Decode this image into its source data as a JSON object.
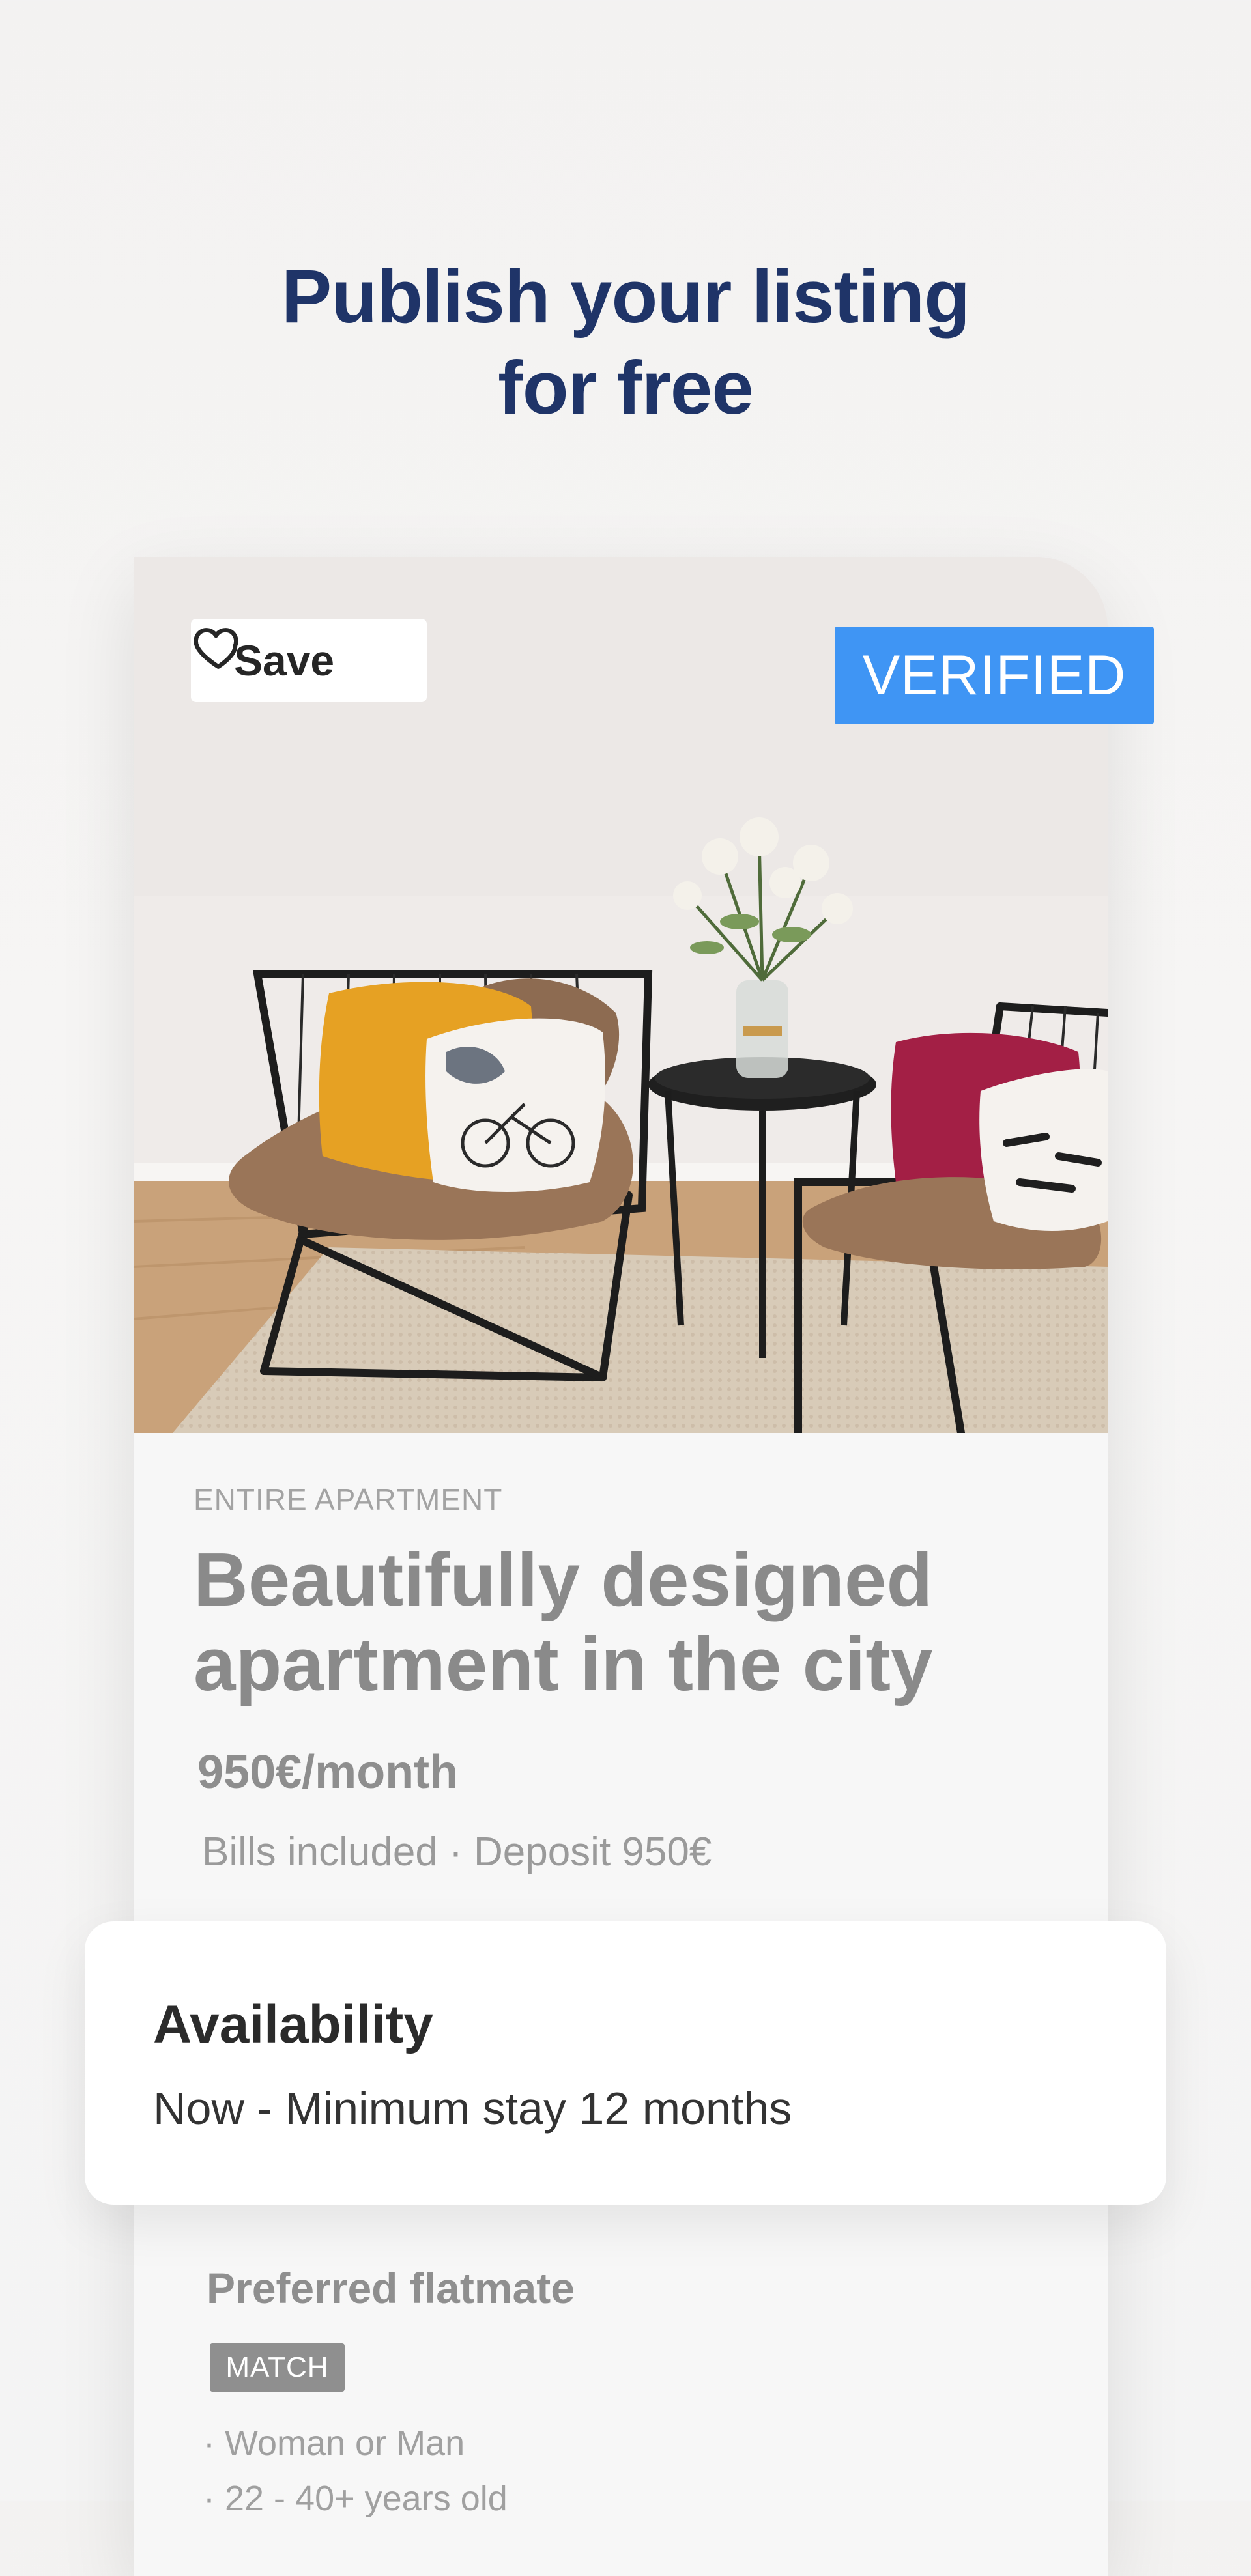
{
  "headline": {
    "line1": "Publish your listing",
    "line2": "for free"
  },
  "listing": {
    "save_label": "Save",
    "verified_label": "VERIFIED",
    "type": "ENTIRE APARTMENT",
    "title_line1": "Beautifully designed",
    "title_line2": "apartment in the city",
    "price": "950€/month",
    "bills": "Bills included · Deposit 950€"
  },
  "availability": {
    "title": "Availability",
    "text": "Now - Minimum stay 12 months"
  },
  "preferred": {
    "title": "Preferred flatmate",
    "badge": "MATCH",
    "line1": "· Woman or Man",
    "line2": "· 22 - 40+ years old"
  },
  "icons": {
    "save": "heart-icon"
  },
  "colors": {
    "headline": "#1f3468",
    "verified_bg": "#3f95f4",
    "match_bg": "#8f8f8f"
  }
}
